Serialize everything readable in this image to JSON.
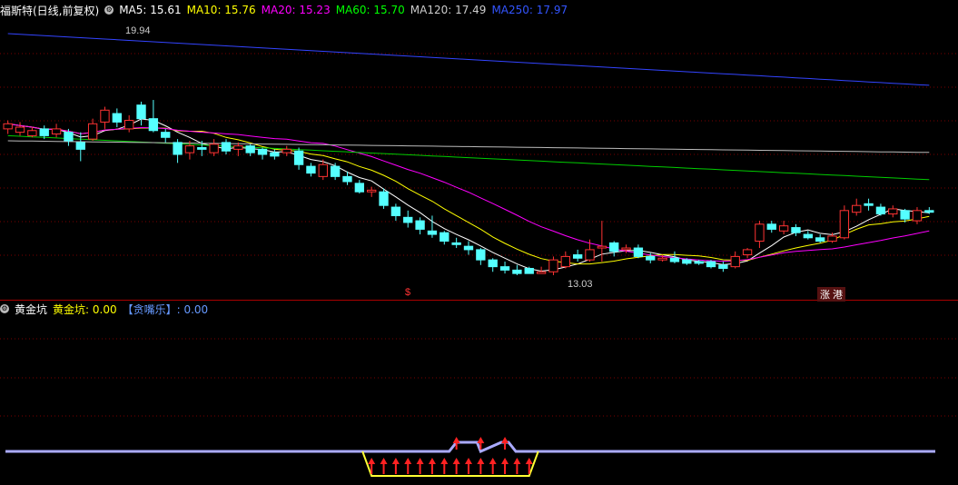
{
  "main_header": {
    "title": "福斯特(日线,前复权)",
    "ma": [
      {
        "label": "MA5: 15.61",
        "color": "#ffffff"
      },
      {
        "label": "MA10: 15.76",
        "color": "#ffff00"
      },
      {
        "label": "MA20: 15.23",
        "color": "#ff00ff"
      },
      {
        "label": "MA60: 15.70",
        "color": "#00ff00"
      },
      {
        "label": "MA120: 17.49",
        "color": "#cccccc"
      },
      {
        "label": "MA250: 17.97",
        "color": "#3355ff"
      }
    ]
  },
  "sub_header": {
    "name": "黄金坑",
    "value_label": "黄金坑: 0.00",
    "tag_label": "【贪嘴乐】: 0.00"
  },
  "markers": {
    "high_label": "19.94",
    "low_label": "13.03",
    "dollar": "$",
    "tags": "涨 港"
  },
  "colors": {
    "up": "#ff3333",
    "down": "#55ffff",
    "grid": "#7a0000",
    "indicator_line": "#aaaaff",
    "pit_line": "#ffff33",
    "arrow": "#ff2222"
  },
  "chart_data": {
    "type": "candlestick",
    "ylim": [
      12.6,
      20.5
    ],
    "candles": [
      [
        17.3,
        17.45,
        17.15,
        17.55
      ],
      [
        17.2,
        17.35,
        17.1,
        17.5
      ],
      [
        17.1,
        17.25,
        17.05,
        17.35
      ],
      [
        17.3,
        17.1,
        17.0,
        17.4
      ],
      [
        17.15,
        17.3,
        17.05,
        17.45
      ],
      [
        17.2,
        16.95,
        16.8,
        17.3
      ],
      [
        16.9,
        16.7,
        16.35,
        17.2
      ],
      [
        17.0,
        17.45,
        16.95,
        17.6
      ],
      [
        17.5,
        17.85,
        17.3,
        17.95
      ],
      [
        17.75,
        17.5,
        17.35,
        17.9
      ],
      [
        17.3,
        17.55,
        17.2,
        17.7
      ],
      [
        18.0,
        17.6,
        17.4,
        18.1
      ],
      [
        17.6,
        17.25,
        17.2,
        18.15
      ],
      [
        17.2,
        17.05,
        16.9,
        17.3
      ],
      [
        16.9,
        16.55,
        16.3,
        17.0
      ],
      [
        16.6,
        16.8,
        16.4,
        16.95
      ],
      [
        16.75,
        16.7,
        16.5,
        16.95
      ],
      [
        16.6,
        16.85,
        16.5,
        17.0
      ],
      [
        16.9,
        16.65,
        16.55,
        17.0
      ],
      [
        16.7,
        16.8,
        16.5,
        16.9
      ],
      [
        16.8,
        16.6,
        16.5,
        16.85
      ],
      [
        16.7,
        16.55,
        16.4,
        16.75
      ],
      [
        16.6,
        16.5,
        16.4,
        16.7
      ],
      [
        16.6,
        16.7,
        16.5,
        16.8
      ],
      [
        16.65,
        16.25,
        16.1,
        16.75
      ],
      [
        16.2,
        16.0,
        15.9,
        16.3
      ],
      [
        15.9,
        16.25,
        15.8,
        16.4
      ],
      [
        16.2,
        15.9,
        15.8,
        16.3
      ],
      [
        15.9,
        15.75,
        15.65,
        16.05
      ],
      [
        15.7,
        15.45,
        15.4,
        15.8
      ],
      [
        15.45,
        15.5,
        15.3,
        15.6
      ],
      [
        15.45,
        15.05,
        14.95,
        15.55
      ],
      [
        15.0,
        14.75,
        14.6,
        15.1
      ],
      [
        14.7,
        14.55,
        14.4,
        14.9
      ],
      [
        14.6,
        14.35,
        14.2,
        14.7
      ],
      [
        14.3,
        14.2,
        14.1,
        14.75
      ],
      [
        14.25,
        14.0,
        13.9,
        14.3
      ],
      [
        13.95,
        13.9,
        13.8,
        14.1
      ],
      [
        13.85,
        13.75,
        13.6,
        14.0
      ],
      [
        13.75,
        13.45,
        13.3,
        13.8
      ],
      [
        13.45,
        13.25,
        13.1,
        13.5
      ],
      [
        13.25,
        13.15,
        13.05,
        13.4
      ],
      [
        13.15,
        13.05,
        13.0,
        13.3
      ],
      [
        13.2,
        13.05,
        13.05,
        13.25
      ],
      [
        13.05,
        13.1,
        13.05,
        13.25
      ],
      [
        13.1,
        13.45,
        13.0,
        13.55
      ],
      [
        13.25,
        13.55,
        13.2,
        13.7
      ],
      [
        13.6,
        13.5,
        13.4,
        13.75
      ],
      [
        13.45,
        13.75,
        13.4,
        14.05
      ],
      [
        13.8,
        13.85,
        13.4,
        14.6
      ],
      [
        13.95,
        13.7,
        13.55,
        14.0
      ],
      [
        13.75,
        13.8,
        13.65,
        13.9
      ],
      [
        13.8,
        13.55,
        13.5,
        13.9
      ],
      [
        13.55,
        13.45,
        13.35,
        13.65
      ],
      [
        13.45,
        13.5,
        13.4,
        13.6
      ],
      [
        13.5,
        13.4,
        13.35,
        13.7
      ],
      [
        13.45,
        13.35,
        13.3,
        13.5
      ],
      [
        13.4,
        13.35,
        13.3,
        13.45
      ],
      [
        13.4,
        13.25,
        13.2,
        13.45
      ],
      [
        13.3,
        13.2,
        13.1,
        13.4
      ],
      [
        13.25,
        13.55,
        13.2,
        13.7
      ],
      [
        13.6,
        13.75,
        13.5,
        13.8
      ],
      [
        14.0,
        14.5,
        13.8,
        14.6
      ],
      [
        14.5,
        14.35,
        14.25,
        14.6
      ],
      [
        14.3,
        14.45,
        14.2,
        14.6
      ],
      [
        14.4,
        14.25,
        14.15,
        14.5
      ],
      [
        14.2,
        14.1,
        14.05,
        14.3
      ],
      [
        14.1,
        14.0,
        13.95,
        14.2
      ],
      [
        14.0,
        14.15,
        13.95,
        14.25
      ],
      [
        14.1,
        14.9,
        14.05,
        15.05
      ],
      [
        14.85,
        15.05,
        14.75,
        15.25
      ],
      [
        15.1,
        15.05,
        14.9,
        15.25
      ],
      [
        15.0,
        14.8,
        14.75,
        15.1
      ],
      [
        14.8,
        14.95,
        14.7,
        15.05
      ],
      [
        14.9,
        14.65,
        14.55,
        14.95
      ],
      [
        14.6,
        14.9,
        14.5,
        15.0
      ],
      [
        14.9,
        14.85,
        14.8,
        15.0
      ]
    ],
    "indicator": {
      "baseline": 0,
      "pit_range": [
        30,
        43
      ],
      "bumps": [
        37,
        39,
        41
      ]
    }
  }
}
